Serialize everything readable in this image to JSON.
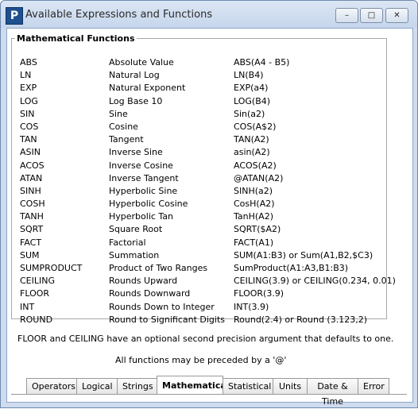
{
  "window": {
    "icon_letter": "P",
    "title": "Available Expressions and Functions"
  },
  "group": {
    "title": "Mathematical Functions",
    "rows": [
      {
        "name": "ABS",
        "desc": "Absolute Value",
        "example": "ABS(A4 - B5)"
      },
      {
        "name": "LN",
        "desc": "Natural Log",
        "example": "LN(B4)"
      },
      {
        "name": "EXP",
        "desc": "Natural Exponent",
        "example": "EXP(a4)"
      },
      {
        "name": "LOG",
        "desc": "Log Base 10",
        "example": "LOG(B4)"
      },
      {
        "name": "SIN",
        "desc": "Sine",
        "example": "Sin(a2)"
      },
      {
        "name": "COS",
        "desc": "Cosine",
        "example": "COS(A$2)"
      },
      {
        "name": "TAN",
        "desc": "Tangent",
        "example": "TAN(A2)"
      },
      {
        "name": "ASIN",
        "desc": "Inverse Sine",
        "example": "asin(A2)"
      },
      {
        "name": "ACOS",
        "desc": "Inverse Cosine",
        "example": "ACOS(A2)"
      },
      {
        "name": "ATAN",
        "desc": "Inverse Tangent",
        "example": "@ATAN(A2)"
      },
      {
        "name": "SINH",
        "desc": "Hyperbolic Sine",
        "example": "SINH(a2)"
      },
      {
        "name": "COSH",
        "desc": "Hyperbolic Cosine",
        "example": "CosH(A2)"
      },
      {
        "name": "TANH",
        "desc": "Hyperbolic Tan",
        "example": "TanH(A2)"
      },
      {
        "name": "SQRT",
        "desc": "Square Root",
        "example": "SQRT($A2)"
      },
      {
        "name": "FACT",
        "desc": "Factorial",
        "example": "FACT(A1)"
      },
      {
        "name": "SUM",
        "desc": "Summation",
        "example": "SUM(A1:B3) or Sum(A1,B2,$C3)"
      },
      {
        "name": "SUMPRODUCT",
        "desc": "Product of Two Ranges",
        "example": "SumProduct(A1:A3,B1:B3)"
      },
      {
        "name": "CEILING",
        "desc": "Rounds Upward",
        "example": "CEILING(3.9) or CEILING(0.234, 0.01)"
      },
      {
        "name": "FLOOR",
        "desc": "Rounds Downward",
        "example": "FLOOR(3.9)"
      },
      {
        "name": "INT",
        "desc": "Rounds Down to Integer",
        "example": "INT(3.9)"
      },
      {
        "name": "ROUND",
        "desc": "Round to Significant Digits",
        "example": "Round(2.4) or Round (3.123,2)"
      }
    ]
  },
  "notes": {
    "line1": "FLOOR and CEILING have an optional second precision argument that defaults to one.",
    "line2": "All functions may be preceded by a '@'"
  },
  "tabs": [
    {
      "label": "Operators",
      "active": false
    },
    {
      "label": "Logical",
      "active": false
    },
    {
      "label": "Strings",
      "active": false
    },
    {
      "label": "Mathematical",
      "active": true
    },
    {
      "label": "Statistical",
      "active": false
    },
    {
      "label": "Units",
      "active": false
    },
    {
      "label": "Date & Time",
      "active": false
    },
    {
      "label": "Error",
      "active": false
    }
  ]
}
